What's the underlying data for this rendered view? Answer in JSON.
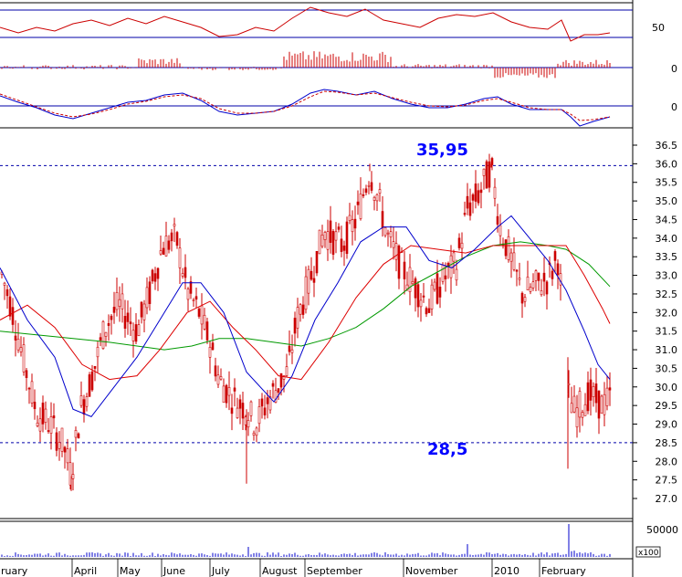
{
  "chart_data": {
    "type": "candlestick",
    "title": "",
    "x_months": [
      "ruary",
      "April",
      "May",
      "June",
      "July",
      "August",
      "September",
      "November",
      "2010",
      "February"
    ],
    "price_axis": {
      "ticks": [
        "27.0",
        "27.5",
        "28.0",
        "28.5",
        "29.0",
        "29.5",
        "30.0",
        "30.5",
        "31.0",
        "31.5",
        "32.0",
        "32.5",
        "33.0",
        "33.5",
        "34.0",
        "34.5",
        "35.0",
        "35.5",
        "36.0",
        "36.5"
      ],
      "range": [
        26.7,
        36.7
      ]
    },
    "levels": [
      {
        "label": "35,95",
        "value": 35.95
      },
      {
        "label": "28,5",
        "value": 28.5
      }
    ],
    "panels": [
      {
        "name": "oscillator",
        "ticks": [
          "50"
        ],
        "lines": [
          50
        ]
      },
      {
        "name": "histogram",
        "ticks": [
          "0"
        ]
      },
      {
        "name": "macd",
        "ticks": [
          "0"
        ]
      },
      {
        "name": "volume",
        "ticks": [
          "50000"
        ],
        "multiplier": "x100"
      }
    ],
    "price_path_keypoints": [
      [
        0,
        33.2
      ],
      [
        12,
        32.2
      ],
      [
        25,
        30.8
      ],
      [
        40,
        29.3
      ],
      [
        55,
        29.0
      ],
      [
        70,
        28.4
      ],
      [
        78,
        27.6
      ],
      [
        88,
        29.4
      ],
      [
        100,
        30.2
      ],
      [
        115,
        31.6
      ],
      [
        130,
        32.2
      ],
      [
        150,
        31.5
      ],
      [
        165,
        32.6
      ],
      [
        178,
        33.8
      ],
      [
        193,
        34.0
      ],
      [
        205,
        32.6
      ],
      [
        218,
        32.0
      ],
      [
        230,
        31.2
      ],
      [
        240,
        30.2
      ],
      [
        255,
        29.7
      ],
      [
        270,
        29.4
      ],
      [
        280,
        29.0
      ],
      [
        295,
        29.7
      ],
      [
        315,
        30.4
      ],
      [
        325,
        31.8
      ],
      [
        340,
        32.9
      ],
      [
        355,
        34.2
      ],
      [
        375,
        33.8
      ],
      [
        390,
        34.5
      ],
      [
        405,
        35.8
      ],
      [
        415,
        35.0
      ],
      [
        425,
        34.0
      ],
      [
        440,
        33.2
      ],
      [
        455,
        32.7
      ],
      [
        470,
        32.2
      ],
      [
        485,
        32.9
      ],
      [
        500,
        33.3
      ],
      [
        512,
        34.8
      ],
      [
        525,
        35.2
      ],
      [
        538,
        35.9
      ],
      [
        548,
        34.3
      ],
      [
        560,
        33.4
      ],
      [
        572,
        32.5
      ],
      [
        585,
        32.7
      ],
      [
        600,
        32.9
      ],
      [
        612,
        33.5
      ],
      [
        622,
        29.8
      ],
      [
        630,
        29.3
      ],
      [
        645,
        29.8
      ],
      [
        660,
        29.5
      ],
      [
        668,
        29.7
      ]
    ],
    "ma_short": [
      [
        0,
        33.2
      ],
      [
        30,
        31.8
      ],
      [
        60,
        30.8
      ],
      [
        80,
        29.4
      ],
      [
        100,
        29.2
      ],
      [
        125,
        30.0
      ],
      [
        150,
        30.8
      ],
      [
        175,
        31.8
      ],
      [
        200,
        32.8
      ],
      [
        220,
        32.8
      ],
      [
        245,
        32.0
      ],
      [
        270,
        30.4
      ],
      [
        300,
        29.6
      ],
      [
        320,
        30.3
      ],
      [
        345,
        31.8
      ],
      [
        370,
        32.8
      ],
      [
        395,
        33.9
      ],
      [
        420,
        34.3
      ],
      [
        445,
        34.3
      ],
      [
        470,
        33.4
      ],
      [
        495,
        33.2
      ],
      [
        520,
        33.7
      ],
      [
        545,
        34.3
      ],
      [
        560,
        34.6
      ],
      [
        580,
        34.0
      ],
      [
        600,
        33.4
      ],
      [
        620,
        32.6
      ],
      [
        640,
        31.5
      ],
      [
        655,
        30.6
      ],
      [
        668,
        30.2
      ]
    ],
    "ma_medium": [
      [
        0,
        31.8
      ],
      [
        30,
        32.2
      ],
      [
        60,
        31.6
      ],
      [
        90,
        30.6
      ],
      [
        120,
        30.2
      ],
      [
        150,
        30.3
      ],
      [
        175,
        31.0
      ],
      [
        205,
        32.0
      ],
      [
        230,
        32.3
      ],
      [
        255,
        31.6
      ],
      [
        280,
        31.0
      ],
      [
        305,
        30.3
      ],
      [
        330,
        30.2
      ],
      [
        360,
        31.2
      ],
      [
        390,
        32.4
      ],
      [
        420,
        33.3
      ],
      [
        450,
        33.8
      ],
      [
        480,
        33.7
      ],
      [
        510,
        33.6
      ],
      [
        540,
        33.8
      ],
      [
        570,
        33.8
      ],
      [
        600,
        33.8
      ],
      [
        620,
        33.8
      ],
      [
        640,
        33.0
      ],
      [
        660,
        32.1
      ],
      [
        668,
        31.7
      ]
    ],
    "ma_long": [
      [
        0,
        31.5
      ],
      [
        40,
        31.4
      ],
      [
        80,
        31.3
      ],
      [
        120,
        31.2
      ],
      [
        150,
        31.1
      ],
      [
        180,
        31.0
      ],
      [
        210,
        31.1
      ],
      [
        240,
        31.3
      ],
      [
        270,
        31.3
      ],
      [
        300,
        31.2
      ],
      [
        330,
        31.1
      ],
      [
        360,
        31.3
      ],
      [
        390,
        31.6
      ],
      [
        420,
        32.1
      ],
      [
        450,
        32.7
      ],
      [
        480,
        33.1
      ],
      [
        510,
        33.5
      ],
      [
        540,
        33.8
      ],
      [
        570,
        33.9
      ],
      [
        600,
        33.8
      ],
      [
        620,
        33.7
      ],
      [
        645,
        33.3
      ],
      [
        668,
        32.7
      ]
    ],
    "colors": {
      "price": "#cc0000",
      "ma_short": "#0000cc",
      "ma_medium": "#dd0000",
      "ma_long": "#009900",
      "level": "#0000aa",
      "annotation": "#0000ff",
      "volume": "#0000cc"
    }
  }
}
